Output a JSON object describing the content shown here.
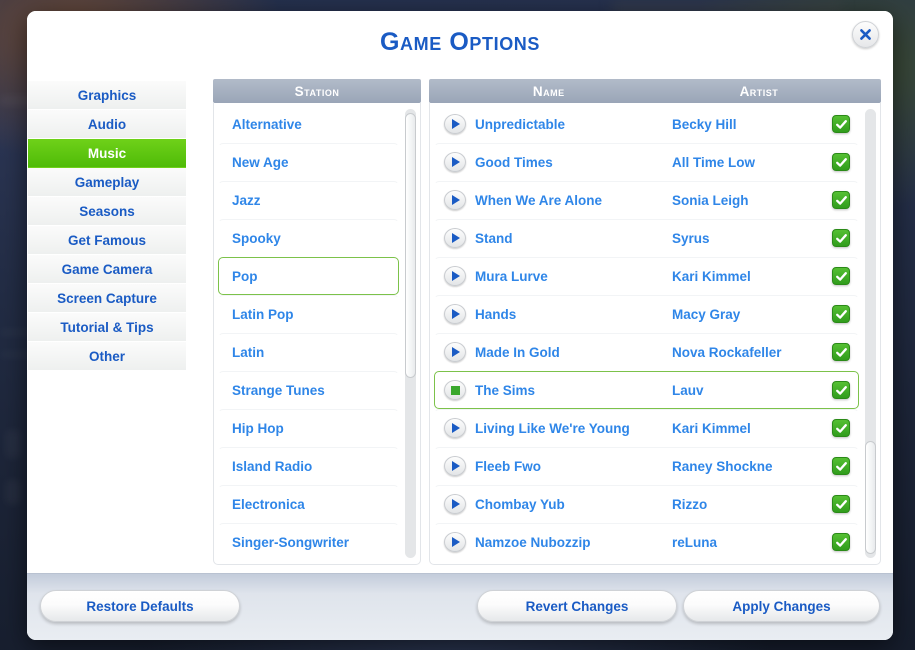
{
  "window": {
    "title": "Game Options",
    "close_icon": "close-icon"
  },
  "sidebar": {
    "items": [
      {
        "label": "Graphics",
        "active": false
      },
      {
        "label": "Audio",
        "active": false
      },
      {
        "label": "Music",
        "active": true
      },
      {
        "label": "Gameplay",
        "active": false
      },
      {
        "label": "Seasons",
        "active": false
      },
      {
        "label": "Get Famous",
        "active": false
      },
      {
        "label": "Game Camera",
        "active": false
      },
      {
        "label": "Screen Capture",
        "active": false
      },
      {
        "label": "Tutorial & Tips",
        "active": false
      },
      {
        "label": "Other",
        "active": false
      }
    ]
  },
  "station_panel": {
    "header": "Station",
    "scroll_thumb_top_pct": 1,
    "scroll_thumb_height_pct": 59,
    "stations": [
      {
        "label": "Alternative",
        "selected": false
      },
      {
        "label": "New Age",
        "selected": false
      },
      {
        "label": "Jazz",
        "selected": false
      },
      {
        "label": "Spooky",
        "selected": false
      },
      {
        "label": "Pop",
        "selected": true
      },
      {
        "label": "Latin Pop",
        "selected": false
      },
      {
        "label": "Latin",
        "selected": false
      },
      {
        "label": "Strange Tunes",
        "selected": false
      },
      {
        "label": "Hip Hop",
        "selected": false
      },
      {
        "label": "Island Radio",
        "selected": false
      },
      {
        "label": "Electronica",
        "selected": false
      },
      {
        "label": "Singer-Songwriter",
        "selected": false
      }
    ]
  },
  "song_panel": {
    "header_name": "Name",
    "header_artist": "Artist",
    "scroll_thumb_top_pct": 74,
    "scroll_thumb_height_pct": 25,
    "songs": [
      {
        "name": "Unpredictable",
        "artist": "Becky Hill",
        "icon": "play-icon",
        "enabled": true,
        "selected": false
      },
      {
        "name": "Good Times",
        "artist": "All Time Low",
        "icon": "play-icon",
        "enabled": true,
        "selected": false
      },
      {
        "name": "When We Are Alone",
        "artist": "Sonia Leigh",
        "icon": "play-icon",
        "enabled": true,
        "selected": false
      },
      {
        "name": "Stand",
        "artist": "Syrus",
        "icon": "play-icon",
        "enabled": true,
        "selected": false
      },
      {
        "name": "Mura Lurve",
        "artist": "Kari Kimmel",
        "icon": "play-icon",
        "enabled": true,
        "selected": false
      },
      {
        "name": "Hands",
        "artist": "Macy Gray",
        "icon": "play-icon",
        "enabled": true,
        "selected": false
      },
      {
        "name": "Made In Gold",
        "artist": "Nova Rockafeller",
        "icon": "play-icon",
        "enabled": true,
        "selected": false
      },
      {
        "name": "The Sims",
        "artist": "Lauv",
        "icon": "stop-icon",
        "enabled": true,
        "selected": true
      },
      {
        "name": "Living Like We're Young",
        "artist": "Kari Kimmel",
        "icon": "play-icon",
        "enabled": true,
        "selected": false
      },
      {
        "name": "Fleeb Fwo",
        "artist": "Raney Shockne",
        "icon": "play-icon",
        "enabled": true,
        "selected": false
      },
      {
        "name": "Chombay Yub",
        "artist": "Rizzo",
        "icon": "play-icon",
        "enabled": true,
        "selected": false
      },
      {
        "name": "Namzoe Nubozzip",
        "artist": "reLuna",
        "icon": "play-icon",
        "enabled": true,
        "selected": false
      }
    ]
  },
  "footer": {
    "restore_label": "Restore Defaults",
    "revert_label": "Revert Changes",
    "apply_label": "Apply Changes"
  },
  "colors": {
    "accent_green": "#4fbb08",
    "link_blue": "#2f86e8",
    "title_blue": "#1a5bc4",
    "header_grey": "#9aa5b7",
    "check_green": "#309d1c"
  }
}
